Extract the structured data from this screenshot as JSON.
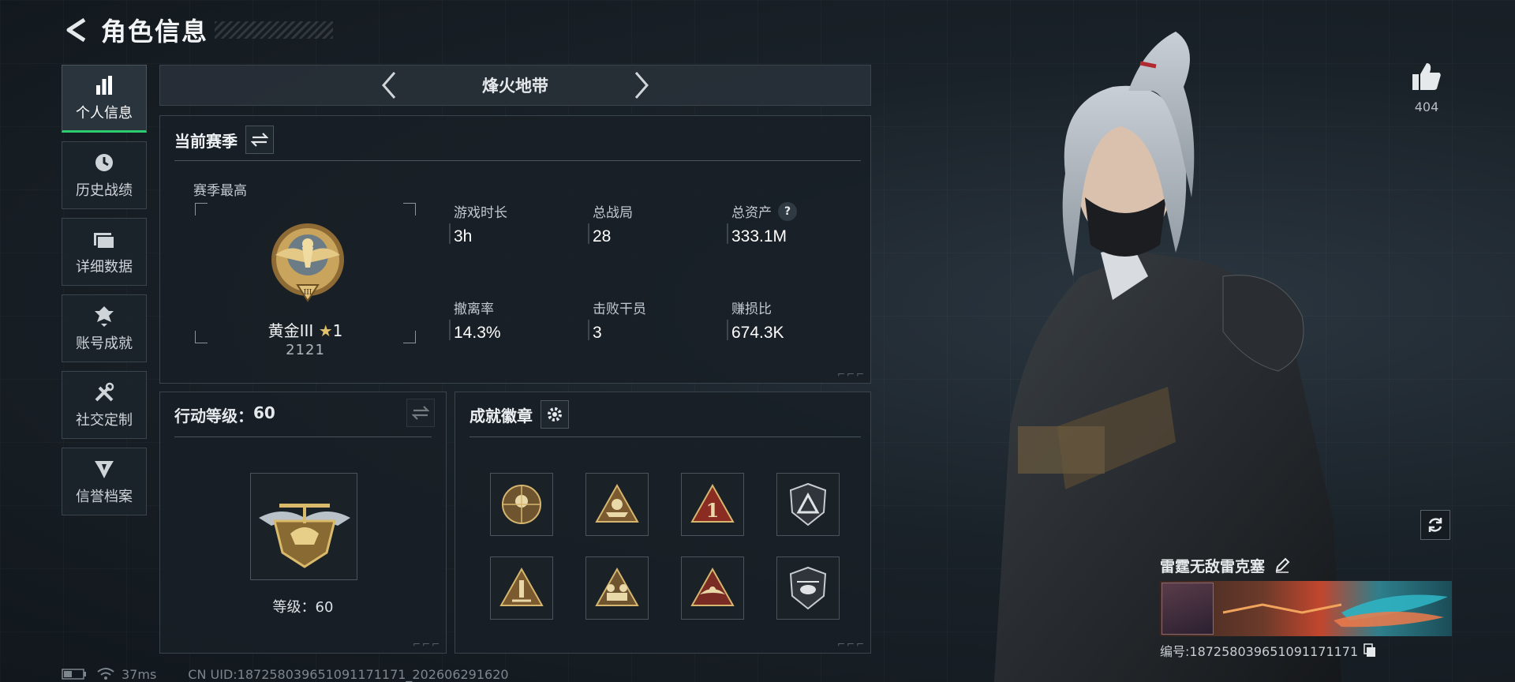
{
  "header": {
    "title": "角色信息"
  },
  "sidebar": {
    "items": [
      {
        "label": "个人信息",
        "icon": "bar-chart-icon",
        "active": true
      },
      {
        "label": "历史战绩",
        "icon": "history-clock-icon",
        "active": false
      },
      {
        "label": "详细数据",
        "icon": "folder-icon",
        "active": false
      },
      {
        "label": "账号成就",
        "icon": "achievement-icon",
        "active": false
      },
      {
        "label": "社交定制",
        "icon": "tools-icon",
        "active": false
      },
      {
        "label": "信誉档案",
        "icon": "reputation-icon",
        "active": false
      }
    ]
  },
  "mode": {
    "title": "烽火地带"
  },
  "season": {
    "title": "当前赛季",
    "best_label": "赛季最高",
    "rank_name": "黄金III",
    "rank_stars": "1",
    "rank_score": "2121",
    "stats": [
      {
        "label": "游戏时长",
        "value": "3h"
      },
      {
        "label": "总战局",
        "value": "28"
      },
      {
        "label": "总资产",
        "value": "333.1M",
        "help": "?"
      },
      {
        "label": "撤离率",
        "value": "14.3%"
      },
      {
        "label": "击败干员",
        "value": "3"
      },
      {
        "label": "赚损比",
        "value": "674.3K"
      }
    ]
  },
  "level": {
    "title_prefix": "行动等级：",
    "title_value": "60",
    "label_prefix": "等级：",
    "label_value": "60"
  },
  "achievements": {
    "title": "成就徽章",
    "badges": [
      "skull-target-badge",
      "boat-badge",
      "rank-one-badge",
      "shield-triangle-badge",
      "rocket-badge",
      "soldiers-badge",
      "eagle-badge",
      "helicopter-badge"
    ]
  },
  "status": {
    "ping": "37ms",
    "uid": "CN UID:187258039651091171171_202606291620"
  },
  "profile": {
    "likes": "404",
    "name": "雷霆无敌雷克塞",
    "id": "编号:187258039651091171171"
  },
  "colors": {
    "accent_green": "#2ecc71",
    "gold": "#c9a45c",
    "panel_border": "#3a444d"
  }
}
